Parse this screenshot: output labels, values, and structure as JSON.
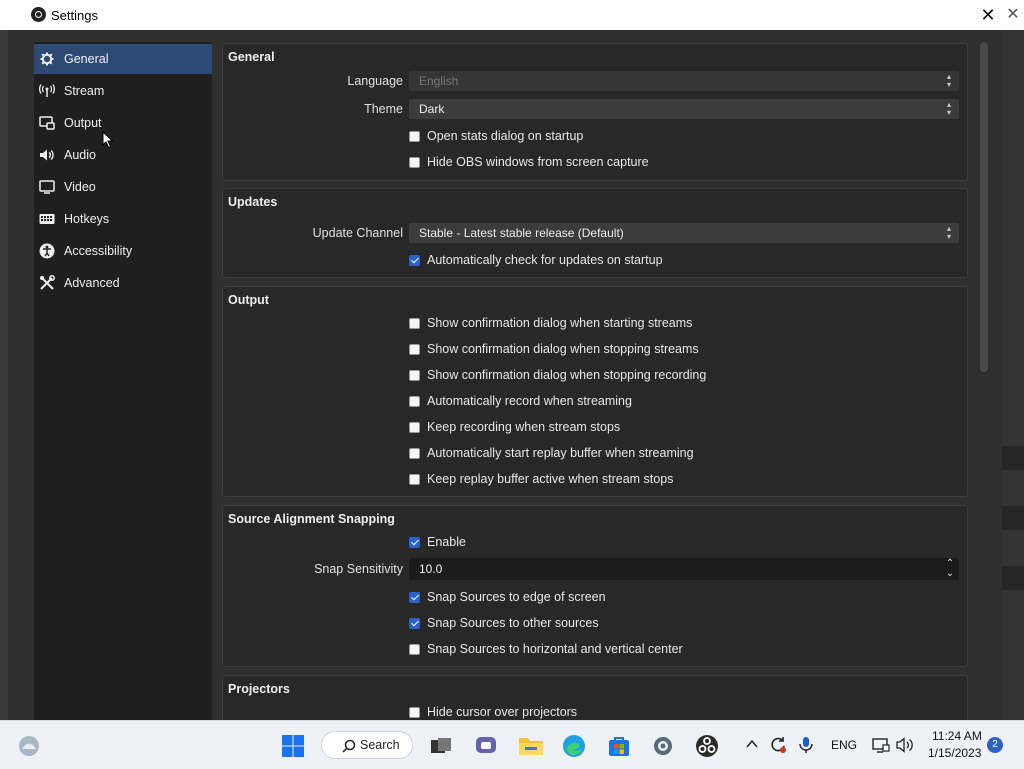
{
  "window": {
    "title": "Settings"
  },
  "sidebar": {
    "items": [
      {
        "label": "General",
        "icon": "gear-icon",
        "active": true
      },
      {
        "label": "Stream",
        "icon": "antenna-icon",
        "active": false
      },
      {
        "label": "Output",
        "icon": "output-icon",
        "active": false
      },
      {
        "label": "Audio",
        "icon": "speaker-icon",
        "active": false
      },
      {
        "label": "Video",
        "icon": "monitor-icon",
        "active": false
      },
      {
        "label": "Hotkeys",
        "icon": "keyboard-icon",
        "active": false
      },
      {
        "label": "Accessibility",
        "icon": "accessibility-icon",
        "active": false
      },
      {
        "label": "Advanced",
        "icon": "tools-icon",
        "active": false
      }
    ]
  },
  "general": {
    "title": "General",
    "language_label": "Language",
    "language_value": "English",
    "theme_label": "Theme",
    "theme_value": "Dark",
    "checks": [
      {
        "label": "Open stats dialog on startup",
        "checked": false
      },
      {
        "label": "Hide OBS windows from screen capture",
        "checked": false
      }
    ]
  },
  "updates": {
    "title": "Updates",
    "channel_label": "Update Channel",
    "channel_value": "Stable - Latest stable release (Default)",
    "checks": [
      {
        "label": "Automatically check for updates on startup",
        "checked": true
      }
    ]
  },
  "output": {
    "title": "Output",
    "checks": [
      {
        "label": "Show confirmation dialog when starting streams",
        "checked": false
      },
      {
        "label": "Show confirmation dialog when stopping streams",
        "checked": false
      },
      {
        "label": "Show confirmation dialog when stopping recording",
        "checked": false
      },
      {
        "label": "Automatically record when streaming",
        "checked": false
      },
      {
        "label": "Keep recording when stream stops",
        "checked": false
      },
      {
        "label": "Automatically start replay buffer when streaming",
        "checked": false
      },
      {
        "label": "Keep replay buffer active when stream stops",
        "checked": false
      }
    ]
  },
  "snapping": {
    "title": "Source Alignment Snapping",
    "enable": {
      "label": "Enable",
      "checked": true
    },
    "sensitivity_label": "Snap Sensitivity",
    "sensitivity_value": "10.0",
    "checks": [
      {
        "label": "Snap Sources to edge of screen",
        "checked": true
      },
      {
        "label": "Snap Sources to other sources",
        "checked": true
      },
      {
        "label": "Snap Sources to horizontal and vertical center",
        "checked": false
      }
    ]
  },
  "projectors": {
    "title": "Projectors",
    "checks": [
      {
        "label": "Hide cursor over projectors",
        "checked": false
      }
    ]
  },
  "taskbar": {
    "search_label": "Search",
    "language": "ENG",
    "time": "11:24 AM",
    "date": "1/15/2023",
    "notification_count": "2"
  }
}
